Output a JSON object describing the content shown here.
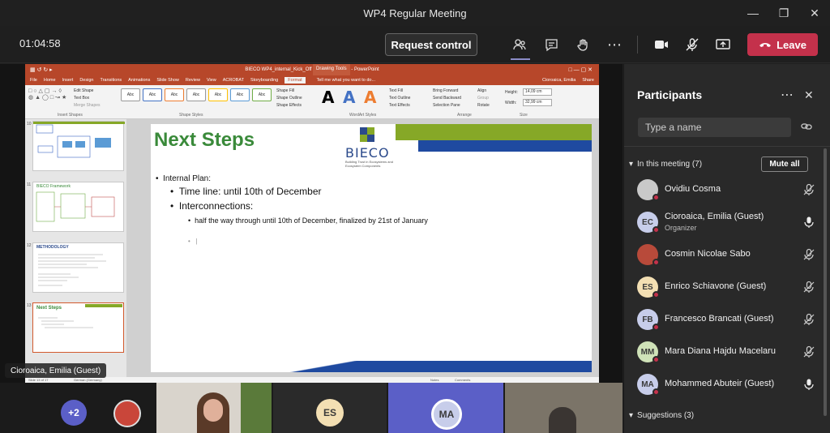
{
  "window": {
    "title": "WP4 Regular Meeting"
  },
  "toolbar": {
    "timer": "01:04:58",
    "request_control": "Request control",
    "leave": "Leave"
  },
  "ppt": {
    "title": "BIECO WP4_internal_Kick_Off (Autosaved).pptx - PowerPoint",
    "drawing_tools": "Drawing Tools",
    "user": "Cioroaica, Emilia",
    "tabs": [
      "File",
      "Home",
      "Insert",
      "Design",
      "Transitions",
      "Animations",
      "Slide Show",
      "Review",
      "View",
      "ACROBAT",
      "Storyboarding",
      "Format"
    ],
    "tell_me": "Tell me what you want to do...",
    "share": "Share",
    "ribbon": {
      "edit_shape": "Edit Shape",
      "text_box": "Text Box",
      "merge_shapes": "Merge Shapes",
      "insert_shapes": "Insert Shapes",
      "shape_styles": "Shape Styles",
      "wordart_styles": "WordArt Styles",
      "arrange": "Arrange",
      "size": "Size",
      "abc": "Abc",
      "shape_fill": "Shape Fill",
      "shape_outline": "Shape Outline",
      "shape_effects": "Shape Effects",
      "text_fill": "Text Fill",
      "text_outline": "Text Outline",
      "text_effects": "Text Effects",
      "bring_forward": "Bring Forward",
      "send_backward": "Send Backward",
      "selection_pane": "Selection Pane",
      "align": "Align",
      "group": "Group",
      "rotate": "Rotate",
      "height_label": "Height:",
      "height": "14,09 cm",
      "width_label": "Width:",
      "width": "32,99 cm"
    },
    "thumbs": [
      {
        "num": "10",
        "title": ""
      },
      {
        "num": "11",
        "title": "BIECO Framework"
      },
      {
        "num": "12",
        "title": "METHODOLOGY"
      },
      {
        "num": "13",
        "title": "Next Steps"
      }
    ],
    "slide": {
      "title": "Next Steps",
      "logo": "BIECO",
      "logo_sub": "Building Trust in Ecosystems and Ecosystem Components",
      "l1": "Internal Plan:",
      "l2": "Time line: until 10th of December",
      "l3": "Interconnections:",
      "l4": "half the way through until 10th of December, finalized by 21st of January"
    },
    "status": {
      "slide": "Slide 13 of 17",
      "lang": "German (Germany)",
      "notes": "Notes",
      "comments": "Comments"
    }
  },
  "presenter_badge": "Cioroaica, Emilia (Guest)",
  "participants": {
    "title": "Participants",
    "search_placeholder": "Type a name",
    "in_meeting": "In this meeting (7)",
    "mute_all": "Mute all",
    "suggestions": "Suggestions (3)",
    "people": [
      {
        "name": "Ovidiu Cosma",
        "initials": "",
        "role": "",
        "color": "#c9c9c9",
        "mic": "muted"
      },
      {
        "name": "Cioroaica, Emilia (Guest)",
        "initials": "EC",
        "role": "Organizer",
        "color": "#c7cdea",
        "mic": "on"
      },
      {
        "name": "Cosmin Nicolae Sabo",
        "initials": "",
        "role": "",
        "color": "#b84a3a",
        "mic": "muted"
      },
      {
        "name": "Enrico Schiavone (Guest)",
        "initials": "ES",
        "role": "",
        "color": "#f3dfb3",
        "mic": "muted"
      },
      {
        "name": "Francesco Brancati (Guest)",
        "initials": "FB",
        "role": "",
        "color": "#c7cdea",
        "mic": "muted"
      },
      {
        "name": "Mara Diana Hajdu Macelaru",
        "initials": "MM",
        "role": "",
        "color": "#cfe2b8",
        "mic": "muted"
      },
      {
        "name": "Mohammed Abuteir (Guest)",
        "initials": "MA",
        "role": "",
        "color": "#c7cdea",
        "mic": "on"
      }
    ]
  },
  "strip": {
    "more": "+2",
    "es": "ES",
    "ma": "MA"
  }
}
